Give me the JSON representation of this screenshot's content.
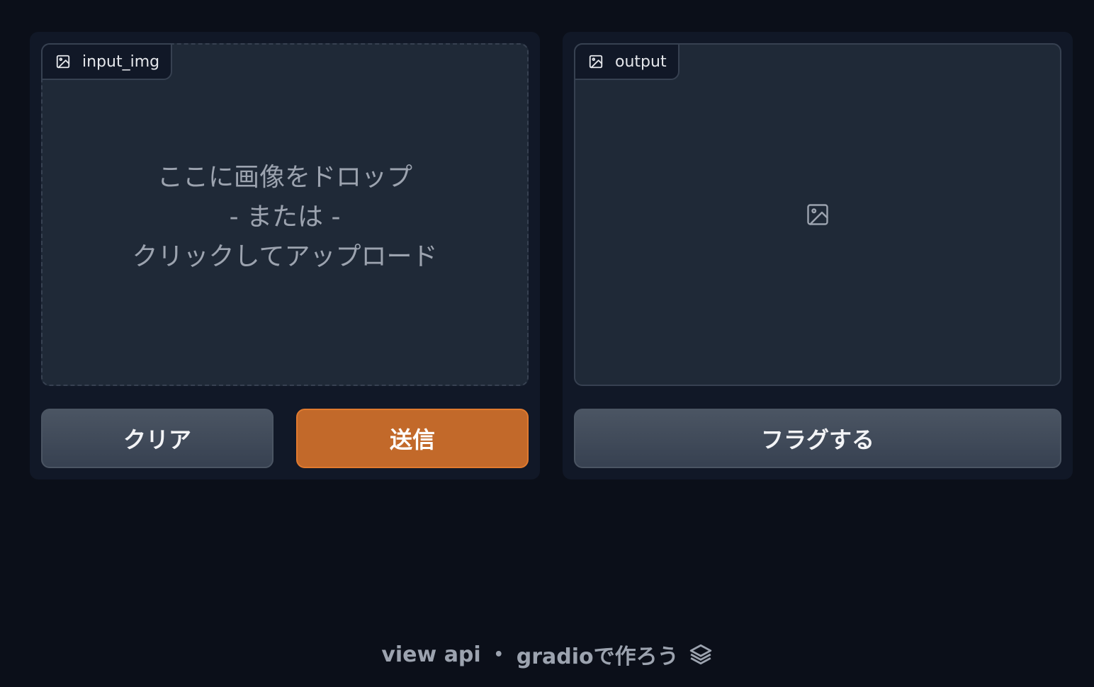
{
  "input": {
    "label": "input_img",
    "drop_line1": "ここに画像をドロップ",
    "drop_line2": "- または -",
    "drop_line3": "クリックしてアップロード"
  },
  "output": {
    "label": "output"
  },
  "buttons": {
    "clear": "クリア",
    "submit": "送信",
    "flag": "フラグする"
  },
  "footer": {
    "api": "view api",
    "separator": "•",
    "built_with": "gradioで作ろう"
  },
  "colors": {
    "background": "#0b0f19",
    "panel": "#111827",
    "primary": "#c2692a",
    "secondary": "#4b5563"
  },
  "icons": {
    "label": "image-icon",
    "empty": "image-icon",
    "footer": "gradio-logo-icon"
  }
}
